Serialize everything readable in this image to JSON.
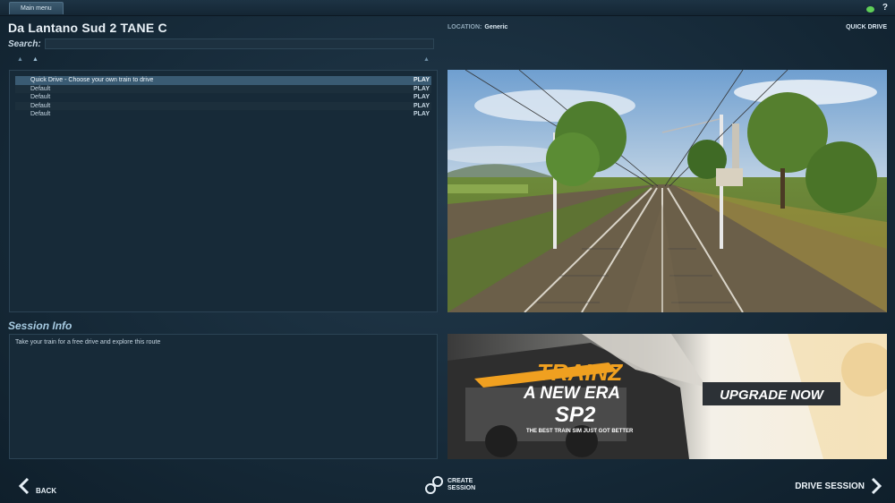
{
  "topbar": {
    "main_menu_label": "Main menu",
    "help_label": "?"
  },
  "header": {
    "title": "Da Lantano Sud 2 TANE C",
    "location_label": "LOCATION:",
    "location_value": "Generic",
    "mode_label": "QUICK DRIVE"
  },
  "search": {
    "label": "Search:",
    "value": "",
    "placeholder": ""
  },
  "sessions": [
    {
      "name": "Quick Drive - Choose your own train to drive",
      "action": "PLAY",
      "selected": true
    },
    {
      "name": "Default",
      "action": "PLAY",
      "selected": false
    },
    {
      "name": "Default",
      "action": "PLAY",
      "selected": false
    },
    {
      "name": "Default",
      "action": "PLAY",
      "selected": false
    },
    {
      "name": "Default",
      "action": "PLAY",
      "selected": false
    }
  ],
  "session_info": {
    "heading": "Session Info",
    "description": "Take your train for a free drive and explore this route"
  },
  "ad": {
    "brand": "TRAINZ",
    "headline": "A NEW ERA",
    "edition": "SP2",
    "tagline": "THE BEST TRAIN SIM JUST GOT BETTER",
    "cta": "UPGRADE NOW"
  },
  "nav": {
    "back_label": "BACK",
    "create_label_line1": "CREATE",
    "create_label_line2": "SESSION",
    "drive_label": "DRIVE SESSION"
  },
  "colors": {
    "background": "#172b3a",
    "panel": "#172a38",
    "selected_row": "#3a5b73",
    "accent_orange": "#f0a020",
    "online_indicator": "#5fcf58"
  }
}
